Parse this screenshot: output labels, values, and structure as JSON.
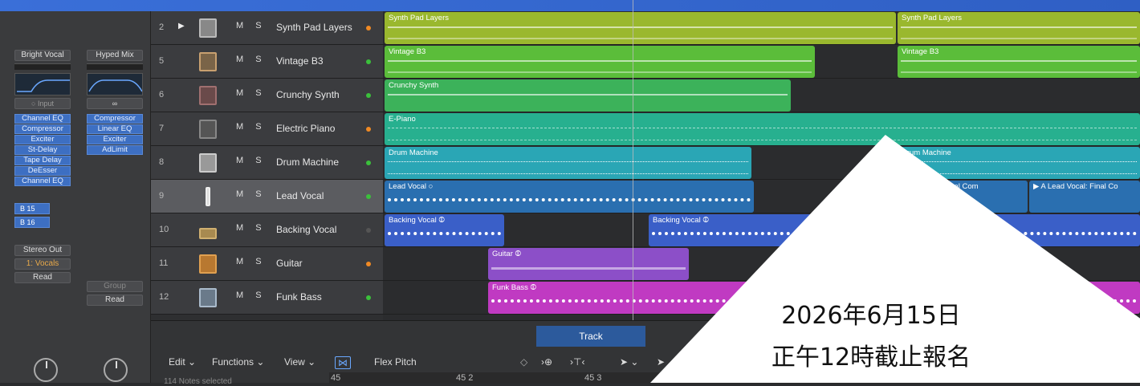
{
  "inspector": {
    "strip1": {
      "name": "Bright Vocal",
      "input": "Input",
      "plugins": [
        "Channel EQ",
        "Compressor",
        "Exciter",
        "St-Delay",
        "Tape Delay",
        "DeEsser",
        "Channel EQ"
      ],
      "buses": [
        "B 15",
        "B 16"
      ],
      "output": "Stereo Out",
      "group": "1: Vocals",
      "auto": "Read"
    },
    "strip2": {
      "name": "Hyped Mix",
      "input": "∞",
      "plugins": [
        "Compressor",
        "Linear EQ",
        "Exciter",
        "AdLimit"
      ],
      "group": "Group",
      "auto": "Read"
    }
  },
  "tracks": [
    {
      "num": "2",
      "name": "Synth Pad Layers",
      "dot": "#f08a24"
    },
    {
      "num": "5",
      "name": "Vintage B3",
      "dot": "#3bc03b"
    },
    {
      "num": "6",
      "name": "Crunchy Synth",
      "dot": "#3bc03b"
    },
    {
      "num": "7",
      "name": "Electric Piano",
      "dot": "#f08a24"
    },
    {
      "num": "8",
      "name": "Drum Machine",
      "dot": "#3bc03b"
    },
    {
      "num": "9",
      "name": "Lead Vocal",
      "dot": "#3bc03b"
    },
    {
      "num": "10",
      "name": "Backing Vocal",
      "dot": "#555555"
    },
    {
      "num": "11",
      "name": "Guitar",
      "dot": "#f08a24"
    },
    {
      "num": "12",
      "name": "Funk Bass",
      "dot": "#3bc03b"
    }
  ],
  "ms_label": "M S",
  "regions": {
    "r0a": "Synth Pad Layers",
    "r0b": "Synth Pad Layers",
    "r1a": "Vintage B3",
    "r1b": "Vintage B3",
    "r2a": "Crunchy Synth",
    "r3a": "E-Piano",
    "r4a": "Drum Machine",
    "r4b": "Drum Machine",
    "r5a": "Lead Vocal",
    "r5b": "Lead Vocal: Final Com",
    "r5c": "A  Lead Vocal: Final Co",
    "r6a": "Backing Vocal",
    "r6b": "Backing Vocal",
    "r7a": "Guitar",
    "r8a": "Funk Bass"
  },
  "colors": {
    "lime": "#9ab82e",
    "green": "#5bbd3a",
    "teal": "#27b08f",
    "cyan": "#2aa6b5",
    "blue": "#2a6fb0",
    "blue2": "#3a5fc8",
    "purple": "#8c4fc8",
    "magenta": "#c03ac2"
  },
  "editor": {
    "tab": "Track",
    "edit": "Edit ⌄",
    "functions": "Functions ⌄",
    "view": "View ⌄",
    "flex": "Flex Pitch",
    "ruler": [
      "45",
      "45 2",
      "45 3"
    ],
    "notes": "114 Notes selected"
  },
  "overlay": {
    "line1": "2026年6月15日",
    "line2": "正午12時截止報名"
  }
}
